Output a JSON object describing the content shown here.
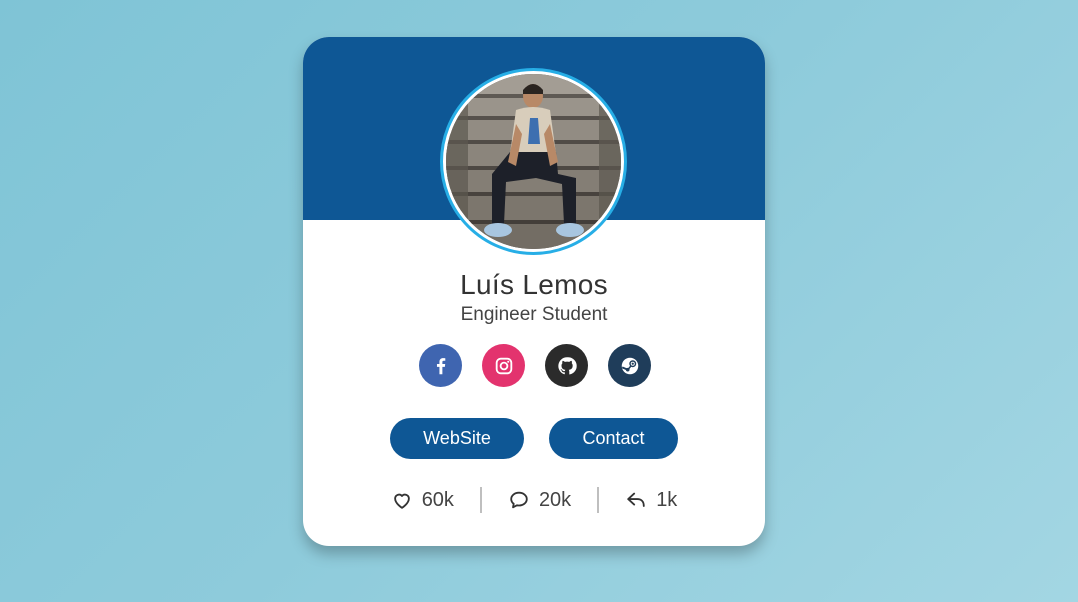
{
  "profile": {
    "name": "Luís Lemos",
    "role": "Engineer Student"
  },
  "social": [
    {
      "icon": "facebook-icon",
      "color": "#3f65b0"
    },
    {
      "icon": "instagram-icon",
      "color": "#e3336e"
    },
    {
      "icon": "github-icon",
      "color": "#2b2b2b"
    },
    {
      "icon": "steam-icon",
      "color": "#1f3d5a"
    }
  ],
  "buttons": {
    "website_label": "WebSite",
    "contact_label": "Contact"
  },
  "stats": {
    "likes": "60k",
    "comments": "20k",
    "shares": "1k"
  },
  "colors": {
    "banner": "#0e5795",
    "avatar_ring": "#27aee6",
    "button": "#0e5795"
  }
}
